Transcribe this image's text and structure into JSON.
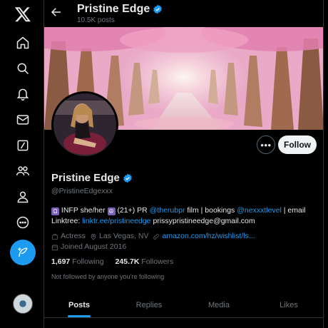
{
  "nav": {
    "items": [
      {
        "name": "x-logo-icon"
      },
      {
        "name": "home-icon"
      },
      {
        "name": "search-icon"
      },
      {
        "name": "notifications-icon"
      },
      {
        "name": "messages-icon"
      },
      {
        "name": "grok-icon"
      },
      {
        "name": "communities-icon"
      },
      {
        "name": "profile-icon"
      },
      {
        "name": "more-icon"
      },
      {
        "name": "post-icon"
      }
    ]
  },
  "header": {
    "name": "Pristine Edge",
    "posts_count": "10.5K posts"
  },
  "profile": {
    "display_name": "Pristine Edge",
    "handle": "@PristineEdgexxx",
    "follow_label": "Follow",
    "more_label": "•••",
    "bio": {
      "part1": "INFP she/her",
      "part2": "(21+) PR",
      "mention1": "@therubpr",
      "part3": "film | bookings",
      "mention2": "@nexxxtlevel",
      "part4": "| email",
      "linktree_label": "Linktree:",
      "linktree_url": "linktr.ee/pristineedge",
      "email": "prissypristineedge@gmail.com"
    },
    "category": "Actress",
    "location": "Las Vegas, NV",
    "website": "amazon.com/hz/wishlist/ls...",
    "joined": "Joined August 2016",
    "following_count": "1,697",
    "following_label": "Following",
    "followers_count": "245.7K",
    "followers_label": "Followers",
    "not_followed_text": "Not followed by anyone you’re following"
  },
  "tabs": [
    {
      "label": "Posts",
      "active": true
    },
    {
      "label": "Replies",
      "active": false
    },
    {
      "label": "Media",
      "active": false
    },
    {
      "label": "Likes",
      "active": false
    }
  ],
  "colors": {
    "accent": "#1d9bf0",
    "background": "#000000",
    "muted_text": "#71767b"
  }
}
